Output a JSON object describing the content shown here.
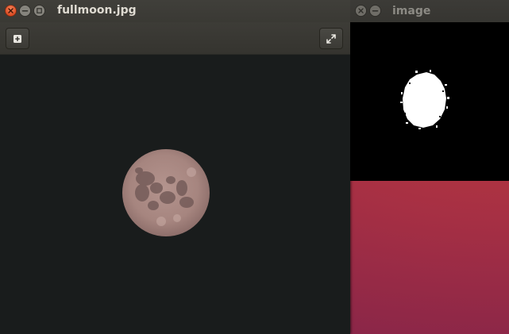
{
  "desktop": {
    "background_color": "#9c2c46"
  },
  "viewer_window": {
    "title": "fullmoon.jpg",
    "buttons": [
      "close-icon",
      "minimize-icon",
      "maximize-icon"
    ],
    "toolbar": {
      "left_button_icon": "add-icon",
      "right_button_icon": "fullscreen-icon"
    },
    "image": {
      "subject": "full-moon",
      "background_color": "#191c1c",
      "moon_color": "#a88782"
    }
  },
  "mask_window": {
    "title": "image",
    "buttons": [
      "close-icon",
      "minimize-icon"
    ],
    "image": {
      "subject": "binary-mask",
      "foreground_color": "#ffffff",
      "background_color": "#000000"
    }
  }
}
